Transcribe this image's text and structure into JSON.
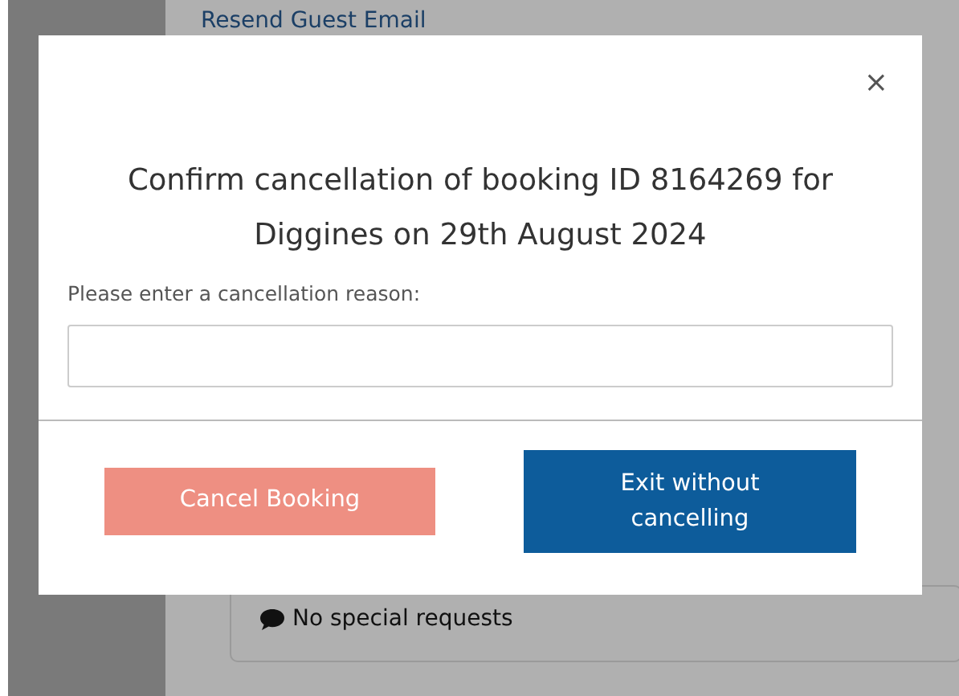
{
  "background": {
    "link": "Resend Guest Email",
    "note": "No special requests"
  },
  "modal": {
    "close": "×",
    "title": "Confirm cancellation of booking ID 8164269 for Diggines on 29th August 2024",
    "label": "Please enter a cancellation reason:",
    "buttons": [
      {
        "label": "Cancel Booking",
        "kind": "danger",
        "disabled": true
      },
      {
        "label": "Exit without cancelling",
        "kind": "primary",
        "disabled": false
      }
    ]
  }
}
